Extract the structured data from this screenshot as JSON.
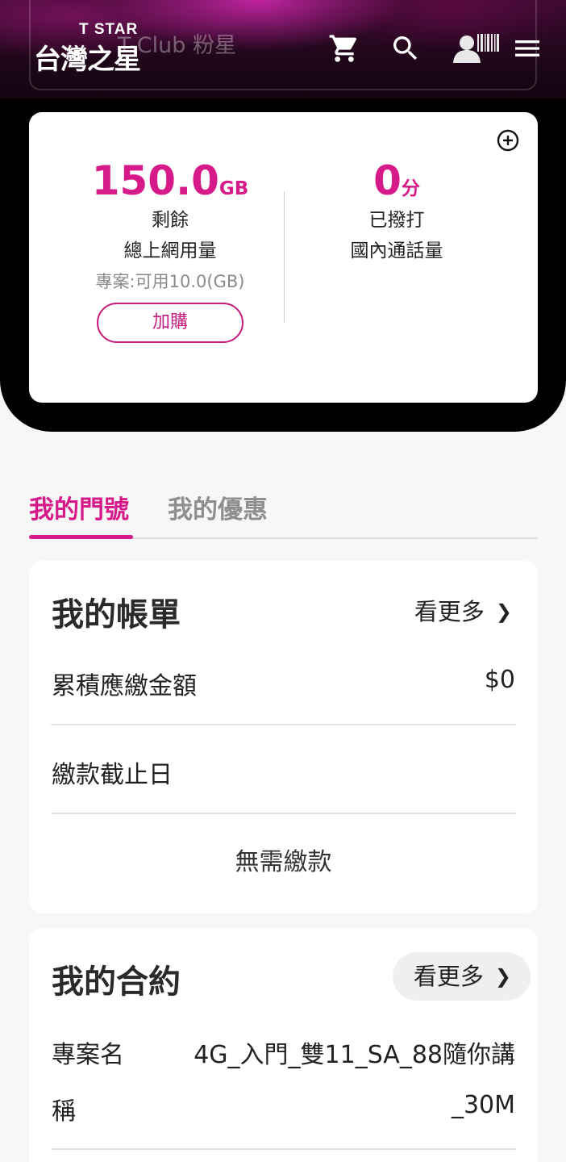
{
  "header": {
    "logo_en": "T STAR",
    "logo_zh": "台灣之星",
    "ghost_text": "T-Club 粉星",
    "icons": [
      "cart-icon",
      "search-icon",
      "member-barcode-icon",
      "menu-icon"
    ],
    "icon_color": "#ffffff"
  },
  "usage": {
    "data": {
      "value": "150.0",
      "unit": "GB",
      "line1": "剩餘",
      "line2": "總上網用量",
      "plan": "專案:可用10.0(GB)",
      "buy_label": "加購"
    },
    "calls": {
      "value": "0",
      "unit": "分",
      "line1": "已撥打",
      "line2": "國內通話量"
    },
    "expand_icon": "plus-circle-icon"
  },
  "tabs": [
    {
      "label": "我的門號",
      "active": true
    },
    {
      "label": "我的優惠",
      "active": false
    }
  ],
  "bill": {
    "title": "我的帳單",
    "more": "看更多",
    "rows": [
      {
        "label": "累積應繳金額",
        "value": "$0"
      },
      {
        "label": "繳款截止日",
        "value": ""
      }
    ],
    "status": "無需繳款"
  },
  "contract": {
    "title": "我的合約",
    "more": "看更多",
    "row_label_1": "專案名",
    "row_label_2": "稱",
    "row_value_1": "4G_入門_雙11_SA_88隨你講",
    "row_value_2": "_30M"
  },
  "colors": {
    "accent": "#d71a8a",
    "accent_border": "#c61c7d",
    "inactive_tab": "#8f8f8f",
    "page_bg": "#f7f7f7"
  }
}
